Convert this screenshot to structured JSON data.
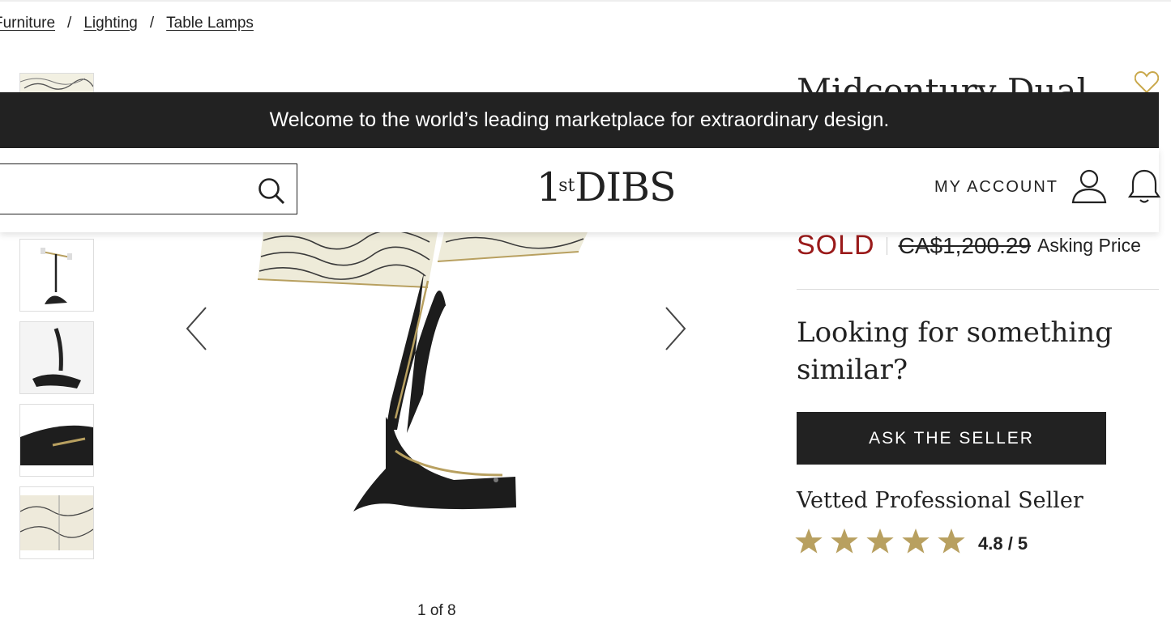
{
  "breadcrumb": {
    "items": [
      "Furniture",
      "Lighting",
      "Table Lamps"
    ],
    "separator": "/"
  },
  "product": {
    "title_partial": "Midcentury Dual"
  },
  "welcome_banner": {
    "text": "Welcome to the world’s leading marketplace for extraordinary design."
  },
  "header": {
    "search": {
      "value": "",
      "placeholder": ""
    },
    "logo": {
      "main": "1",
      "sup": "st",
      "brand": "DIBS"
    },
    "account_label": "MY ACCOUNT"
  },
  "gallery": {
    "counter": "1 of 8",
    "thumbnail_count": 5
  },
  "price": {
    "status": "SOLD",
    "amount": "CA$1,200.29",
    "label": "Asking Price"
  },
  "inquiry": {
    "heading": "Looking for something similar?",
    "button_label": "ASK THE SELLER"
  },
  "seller": {
    "badge": "Vetted Professional Seller",
    "rating": 4.8,
    "rating_text": "4.8 / 5"
  },
  "colors": {
    "sold": "#9a1a1a",
    "star": "#b8a060",
    "dark": "#222222"
  },
  "icons": [
    "search-icon",
    "user-icon",
    "bell-icon",
    "heart-icon",
    "chevron-left-icon",
    "chevron-right-icon",
    "star-icon"
  ]
}
